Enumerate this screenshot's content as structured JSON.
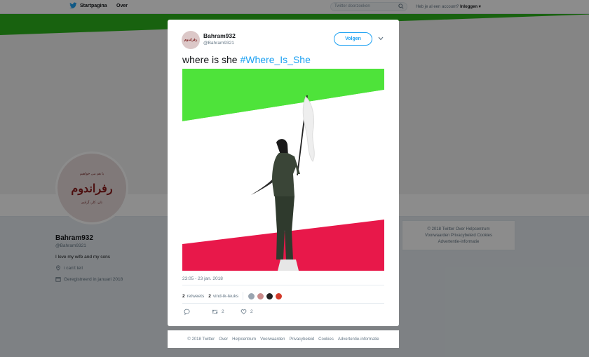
{
  "nav": {
    "home_label": "Startpagina",
    "over_label": "Over",
    "search_placeholder": "Twitter doorzoeken",
    "account_prompt": "Heb je al een account?",
    "login_label": "Inloggen"
  },
  "profile": {
    "name": "Bahram932",
    "handle": "@Bahram9321",
    "bio": "I love my wife and my sons",
    "location": "i can't tell",
    "joined": "Geregistreerd in januari 2018",
    "avatar_words": {
      "top": "با هم می خواهیم",
      "main": "رفراندوم",
      "bottom": "نان، کار، آزادی"
    }
  },
  "side_footer": {
    "line1": "© 2018 Twitter   Over   Helpcentrum",
    "line2": "Voorwaarden   Privacybeleid   Cookies",
    "line3": "Advertentie-informatie"
  },
  "tweet": {
    "author_name": "Bahram932",
    "author_handle": "@Bahram9321",
    "follow_label": "Volgen",
    "text": "where is she",
    "hashtag": "#Where_Is_She",
    "timestamp": "23:05 - 23 jan. 2018",
    "retweets_count": "2",
    "retweets_label": "retweets",
    "likes_count": "2",
    "likes_label": "vind-ik-leuks",
    "retweet_action_count": "2",
    "like_action_count": "2",
    "liker_colors": [
      "#9aa5b1",
      "#c98b8b",
      "#222222",
      "#d33a2a"
    ]
  },
  "modal_footer": {
    "copyright": "© 2018 Twitter",
    "over": "Over",
    "help": "Helpcentrum",
    "terms": "Voorwaarden",
    "privacy": "Privacybeleid",
    "cookies": "Cookies",
    "ads": "Advertentie-informatie"
  },
  "colors": {
    "accent": "#1da1f2",
    "flag_green": "#4ee33a",
    "flag_red": "#e8184a"
  }
}
